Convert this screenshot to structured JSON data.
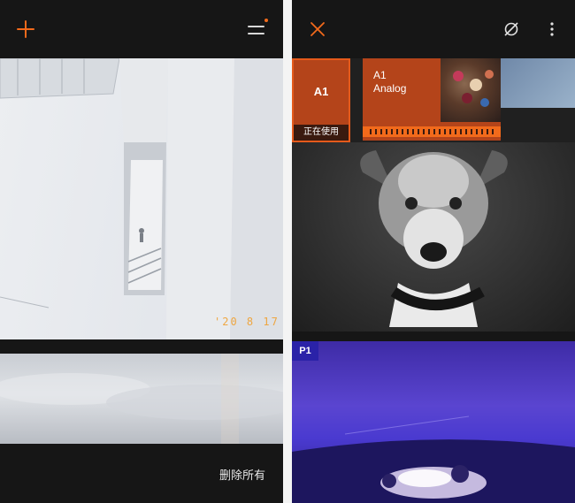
{
  "left_screen": {
    "toolbar": {
      "add_icon": "plus-icon",
      "menu_icon": "menu-lines-icon",
      "menu_notification_dot": true
    },
    "photos": [
      {
        "subject": "white building exterior"
      },
      {
        "subject": "cloudy sky"
      }
    ],
    "date_stamp": "'20 8 17",
    "delete_all_label": "删除所有"
  },
  "right_screen": {
    "toolbar": {
      "close_icon": "close-x-icon",
      "no_filter_icon": "empty-set-icon",
      "more_icon": "more-vertical-icon"
    },
    "filters": [
      {
        "name": "A1",
        "status": "正在使用",
        "active": true
      },
      {
        "name": "A1\nAnalog",
        "name_line1": "A1",
        "name_line2": "Analog",
        "active": false
      }
    ],
    "photos": [
      {
        "subject": "dog portrait black and white"
      },
      {
        "subject": "campfire under night sky",
        "badge": "P1"
      }
    ]
  },
  "colors": {
    "accent": "#f26a1b",
    "filter_card": "#b4441a",
    "background": "#161616"
  }
}
